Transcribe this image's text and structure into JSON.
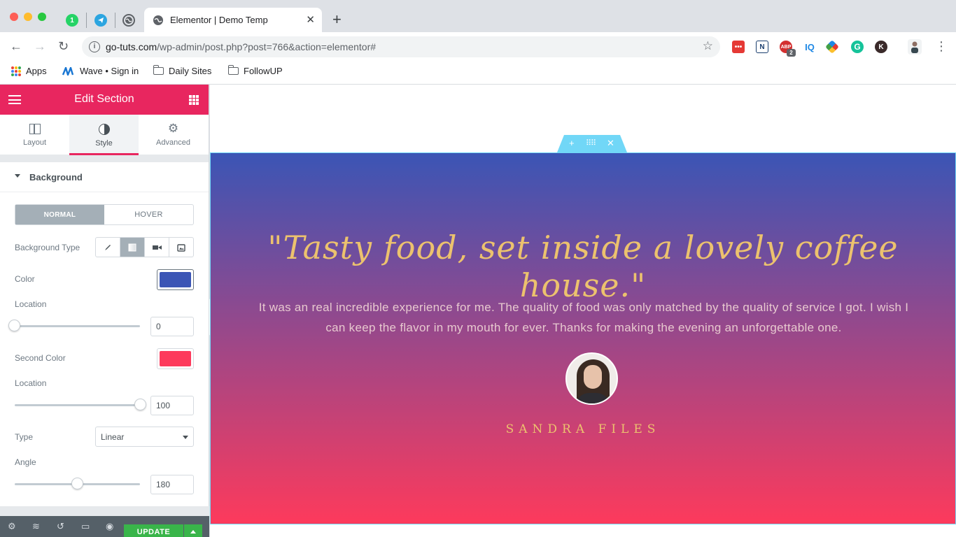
{
  "browser": {
    "pinned_tabs": [
      {
        "icon": "whatsapp-icon",
        "badge": "1",
        "color": "#25d366"
      },
      {
        "icon": "telegram-icon",
        "color": "#2ca5e0"
      },
      {
        "icon": "globe-icon",
        "color": "#5f6368"
      }
    ],
    "active_tab_title": "Elementor | Demo Temp",
    "url_domain": "go-tuts.com",
    "url_path": "/wp-admin/post.php?post=766&action=elementor#",
    "extension_badge": "2",
    "bookmarks": [
      "Apps",
      "Wave • Sign in",
      "Daily Sites",
      "FollowUP"
    ]
  },
  "panel": {
    "header_title": "Edit Section",
    "tabs": [
      "Layout",
      "Style",
      "Advanced"
    ],
    "section_title": "Background",
    "state_switch": {
      "normal": "NORMAL",
      "hover": "HOVER"
    },
    "background_type_label": "Background Type",
    "color_label": "Color",
    "color_value": "#3b55b5",
    "location_label": "Location",
    "location_value": "0",
    "second_color_label": "Second Color",
    "second_color_value": "#fd3a5c",
    "second_location_label": "Location",
    "second_location_value": "100",
    "type_label": "Type",
    "type_value": "Linear",
    "angle_label": "Angle",
    "angle_value": "180",
    "update_label": "UPDATE"
  },
  "hero": {
    "quote": "\"Tasty food, set inside a lovely coffee house.\"",
    "body": "It was an real incredible experience for me. The quality of food was only matched by the quality of service I got. I wish I can keep the flavor in my mouth for ever. Thanks for making the evening an unforgettable one.",
    "name": "SANDRA FILES",
    "gradient_start": "#3b55b5",
    "gradient_end": "#fd3a5c",
    "quote_color": "#ecc26e",
    "body_color": "#e7c9cf",
    "name_color": "#ecc26e"
  }
}
